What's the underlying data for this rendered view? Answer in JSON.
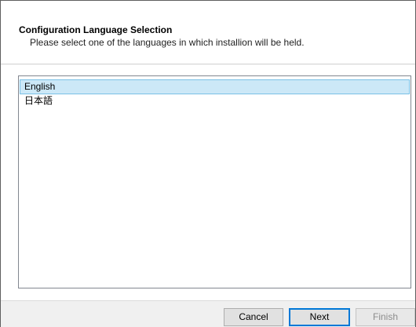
{
  "header": {
    "title": "Configuration Language Selection",
    "description": "Please select one of the languages in which installion will be held."
  },
  "languages": {
    "items": [
      {
        "label": "English",
        "selected": true
      },
      {
        "label": "日本語",
        "selected": false
      }
    ]
  },
  "footer": {
    "cancel_label": "Cancel",
    "next_label": "Next",
    "finish_label": "Finish",
    "finish_enabled": false
  },
  "colors": {
    "selection_background": "#cce8f7",
    "selection_border": "#7ac1e6",
    "default_button_border": "#0078d7",
    "dialog_background": "#f0f0f0"
  }
}
